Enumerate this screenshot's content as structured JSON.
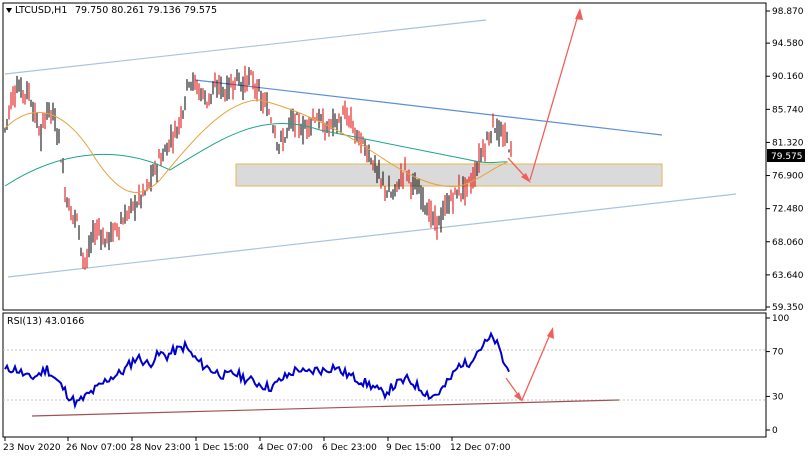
{
  "window": {
    "title_symbol": "LTCUSD,H1",
    "ohlc": "79.750 80.261 79.136 79.575"
  },
  "price_panel": {
    "y_ticks": [
      "98.870",
      "94.580",
      "90.160",
      "85.740",
      "81.320",
      "76.900",
      "72.480",
      "68.060",
      "63.640",
      "59.350"
    ],
    "y_tick_values": [
      98.87,
      94.58,
      90.16,
      85.74,
      81.32,
      76.9,
      72.48,
      68.06,
      63.64,
      59.35
    ],
    "current_price": "79.575",
    "current_price_value": 79.575,
    "zone": {
      "from": 76.1,
      "to": 78.4
    },
    "colors": {
      "bull": "#000000",
      "bear": "#e00000",
      "ma_fast": "#e8a23a",
      "ma_slow": "#1aa58a",
      "trend": "#5b8fd9",
      "channel": "#a9c3de",
      "arrow": "#f0605a",
      "zone_fill": "#d9d9d9",
      "zone_border": "#e8b24a",
      "badge": "#000000"
    }
  },
  "rsi_panel": {
    "label": "RSI(13) 43.0166",
    "y_ticks": [
      "100",
      "70",
      "30",
      "0"
    ],
    "y_tick_values": [
      100,
      70,
      30,
      0
    ],
    "colors": {
      "line": "#0000cc",
      "support": "#a05252"
    }
  },
  "x_axis": {
    "labels": [
      "23 Nov 2020",
      "26 Nov 07:00",
      "28 Nov 23:00",
      "1 Dec 15:00",
      "4 Dec 07:00",
      "6 Dec 23:00",
      "9 Dec 15:00",
      "12 Dec 07:00"
    ]
  },
  "price_series": [
    [
      0,
      83
    ],
    [
      6,
      87
    ],
    [
      12,
      89
    ],
    [
      18,
      88
    ],
    [
      24,
      88
    ],
    [
      30,
      85
    ],
    [
      36,
      82
    ],
    [
      42,
      86
    ],
    [
      48,
      85
    ],
    [
      54,
      82
    ],
    [
      60,
      75
    ],
    [
      66,
      72
    ],
    [
      72,
      71
    ],
    [
      78,
      66
    ],
    [
      82,
      65.5
    ],
    [
      88,
      69
    ],
    [
      94,
      70
    ],
    [
      100,
      68
    ],
    [
      106,
      69
    ],
    [
      112,
      70
    ],
    [
      118,
      71
    ],
    [
      124,
      72
    ],
    [
      130,
      73
    ],
    [
      136,
      74
    ],
    [
      142,
      75
    ],
    [
      148,
      77
    ],
    [
      154,
      79
    ],
    [
      160,
      80
    ],
    [
      166,
      82
    ],
    [
      172,
      83
    ],
    [
      178,
      86
    ],
    [
      184,
      90
    ],
    [
      190,
      89
    ],
    [
      196,
      88
    ],
    [
      202,
      87
    ],
    [
      208,
      88
    ],
    [
      214,
      89
    ],
    [
      220,
      88
    ],
    [
      226,
      89
    ],
    [
      232,
      90
    ],
    [
      238,
      89
    ],
    [
      244,
      90
    ],
    [
      250,
      89
    ],
    [
      256,
      87
    ],
    [
      262,
      86
    ],
    [
      268,
      84
    ],
    [
      274,
      81
    ],
    [
      280,
      82
    ],
    [
      286,
      84
    ],
    [
      292,
      84
    ],
    [
      298,
      83
    ],
    [
      304,
      84
    ],
    [
      310,
      85
    ],
    [
      316,
      84
    ],
    [
      322,
      83
    ],
    [
      328,
      84
    ],
    [
      334,
      84
    ],
    [
      340,
      85
    ],
    [
      346,
      84
    ],
    [
      352,
      82
    ],
    [
      358,
      81
    ],
    [
      364,
      80
    ],
    [
      370,
      78
    ],
    [
      376,
      76
    ],
    [
      382,
      75
    ],
    [
      388,
      74
    ],
    [
      394,
      76
    ],
    [
      400,
      78
    ],
    [
      406,
      76
    ],
    [
      412,
      75
    ],
    [
      418,
      74
    ],
    [
      424,
      72
    ],
    [
      430,
      70.5
    ],
    [
      436,
      71
    ],
    [
      442,
      73
    ],
    [
      448,
      74
    ],
    [
      454,
      75
    ],
    [
      460,
      75
    ],
    [
      466,
      76
    ],
    [
      472,
      78
    ],
    [
      476,
      80
    ],
    [
      480,
      81
    ],
    [
      484,
      82
    ],
    [
      488,
      84
    ],
    [
      492,
      83
    ],
    [
      496,
      82
    ],
    [
      500,
      82
    ],
    [
      504,
      81
    ],
    [
      508,
      80
    ]
  ],
  "rsi_series": [
    [
      0,
      53
    ],
    [
      6,
      55
    ],
    [
      12,
      54
    ],
    [
      18,
      50
    ],
    [
      24,
      46
    ],
    [
      30,
      48
    ],
    [
      36,
      51
    ],
    [
      42,
      55
    ],
    [
      48,
      48
    ],
    [
      54,
      42
    ],
    [
      60,
      35
    ],
    [
      66,
      28
    ],
    [
      72,
      24
    ],
    [
      78,
      28
    ],
    [
      84,
      32
    ],
    [
      90,
      36
    ],
    [
      96,
      40
    ],
    [
      102,
      45
    ],
    [
      108,
      48
    ],
    [
      114,
      50
    ],
    [
      120,
      54
    ],
    [
      126,
      60
    ],
    [
      132,
      65
    ],
    [
      138,
      62
    ],
    [
      144,
      58
    ],
    [
      150,
      65
    ],
    [
      156,
      68
    ],
    [
      162,
      66
    ],
    [
      168,
      70
    ],
    [
      174,
      72
    ],
    [
      180,
      75
    ],
    [
      186,
      68
    ],
    [
      192,
      62
    ],
    [
      198,
      58
    ],
    [
      204,
      55
    ],
    [
      210,
      52
    ],
    [
      216,
      50
    ],
    [
      222,
      48
    ],
    [
      228,
      51
    ],
    [
      234,
      49
    ],
    [
      240,
      46
    ],
    [
      246,
      44
    ],
    [
      252,
      42
    ],
    [
      258,
      40
    ],
    [
      264,
      38
    ],
    [
      270,
      40
    ],
    [
      276,
      45
    ],
    [
      282,
      48
    ],
    [
      288,
      52
    ],
    [
      294,
      55
    ],
    [
      300,
      50
    ],
    [
      306,
      52
    ],
    [
      312,
      54
    ],
    [
      318,
      53
    ],
    [
      324,
      55
    ],
    [
      330,
      57
    ],
    [
      336,
      52
    ],
    [
      342,
      50
    ],
    [
      348,
      47
    ],
    [
      354,
      45
    ],
    [
      360,
      42
    ],
    [
      366,
      40
    ],
    [
      372,
      36
    ],
    [
      378,
      32
    ],
    [
      384,
      36
    ],
    [
      390,
      40
    ],
    [
      396,
      43
    ],
    [
      402,
      45
    ],
    [
      408,
      42
    ],
    [
      414,
      38
    ],
    [
      420,
      34
    ],
    [
      426,
      30
    ],
    [
      432,
      32
    ],
    [
      438,
      37
    ],
    [
      444,
      44
    ],
    [
      450,
      52
    ],
    [
      456,
      60
    ],
    [
      462,
      58
    ],
    [
      468,
      66
    ],
    [
      474,
      72
    ],
    [
      480,
      77
    ],
    [
      486,
      82
    ],
    [
      490,
      80
    ],
    [
      494,
      72
    ],
    [
      498,
      62
    ],
    [
      502,
      55
    ],
    [
      506,
      48
    ]
  ]
}
